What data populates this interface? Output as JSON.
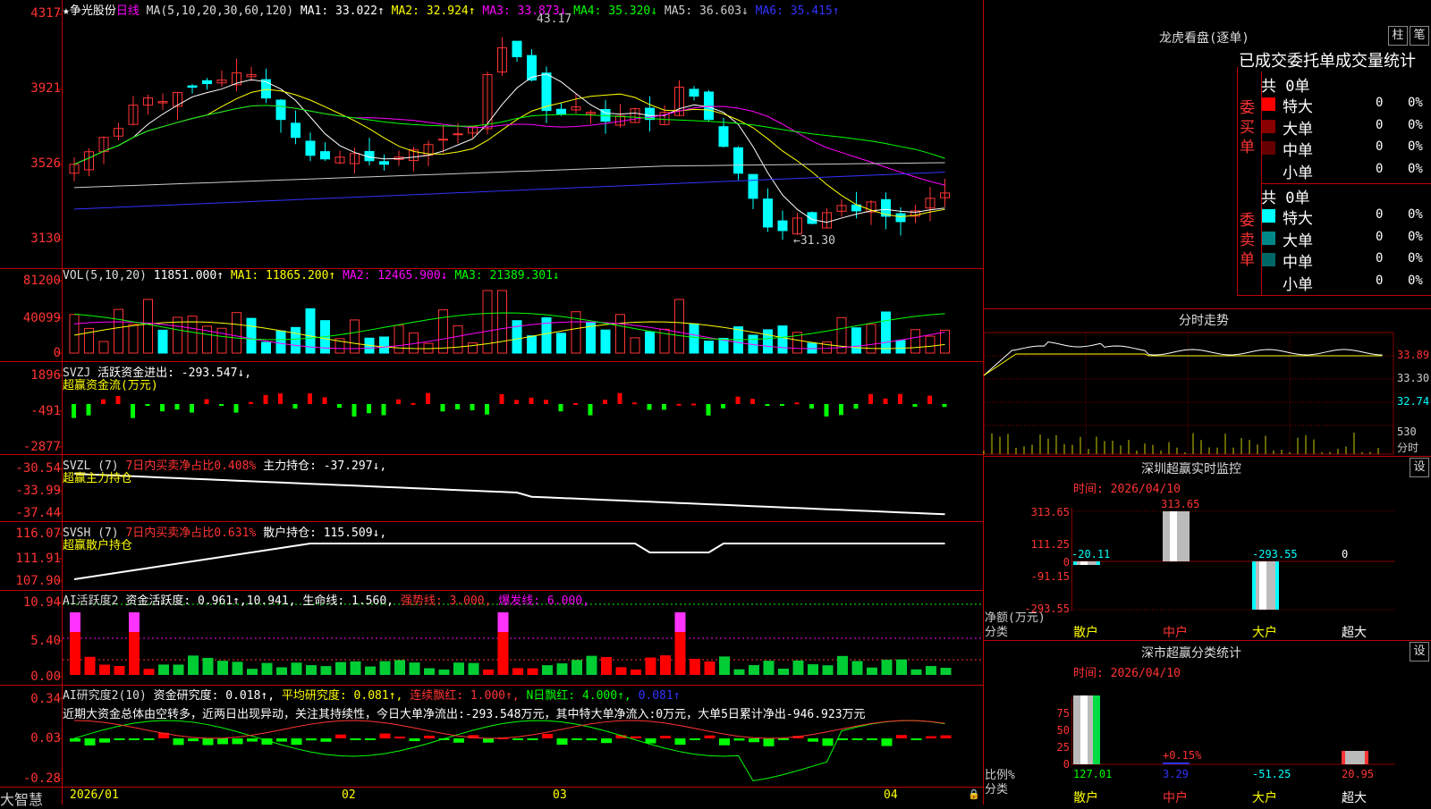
{
  "stock": {
    "name": "★争光股份",
    "period": "日线"
  },
  "main": {
    "ma_label": "MA(5,10,20,30,60,120)",
    "ma1": "MA1: 33.022↑",
    "ma2": "MA2: 32.924↑",
    "ma3": "MA3: 33.873↓",
    "ma4": "MA4: 35.320↓",
    "ma5": "MA5: 36.603↓",
    "ma6": "MA6: 35.415↑",
    "axis": [
      "4317",
      "3921",
      "3526",
      "3130"
    ],
    "high_label": "43.17",
    "low_label": "←31.30"
  },
  "vol": {
    "label": "VOL(5,10,20)",
    "val": "11851.000↑",
    "ma1": "MA1: 11865.200↑",
    "ma2": "MA2: 12465.900↓",
    "ma3": "MA3: 21389.301↓",
    "axis": [
      "81200",
      "40099",
      "0"
    ]
  },
  "svzj": {
    "label": "SVZJ",
    "text": "活跃资金进出: -293.547↓,",
    "sub": "超赢资金流(万元)",
    "axis": [
      "1896",
      "-491",
      "-2877"
    ]
  },
  "svzl": {
    "label": "SVZL (7)",
    "t1": "7日内买卖净占比0.408%",
    "t2": "主力持仓: -37.297↓,",
    "sub": "超赢主力持仓",
    "axis": [
      "-30.54",
      "-33.99",
      "-37.44"
    ]
  },
  "svsh": {
    "label": "SVSH (7)",
    "t1": "7日内买卖净占比0.631%",
    "t2": "散户持仓: 115.509↓,",
    "sub": "超赢散户持仓",
    "axis": [
      "116.07",
      "111.91",
      "107.90"
    ]
  },
  "ai1": {
    "label": "AI活跃度2",
    "t1": "资金活跃度: 0.961↑,10.941,",
    "t2": "生命线: 1.560,",
    "t3": "强势线: 3.000,",
    "t4": "爆发线: 6.000,",
    "axis": [
      "10.94",
      "5.40",
      "0.00"
    ]
  },
  "ai2": {
    "label": "AI研究度2(10)",
    "t1": "资金研究度: 0.018↑,",
    "t2": "平均研究度: 0.081↑,",
    "t3": "连续飘红: 1.000↑,",
    "t4": "N日飘红: 4.000↑,",
    "t5": "0.081↑",
    "note": "近期大资金总体由空转多，近两日出现异动，关注其持续性，今日大单净流出:-293.548万元，其中特大单净流入:0万元，大单5日累计净出-946.923万元",
    "axis": [
      "0.34",
      "0.03",
      "-0.28"
    ]
  },
  "dates": {
    "d1": "2026/01",
    "d2": "02",
    "d3": "03",
    "d4": "04"
  },
  "brand": "大智慧",
  "lhb": {
    "title": "龙虎看盘(逐单)",
    "btn1": "柱",
    "btn2": "笔",
    "subtitle": "已成交委托单成交量统计",
    "buy_label": "委买单",
    "sell_label": "委卖单",
    "buy_total": "共 0单",
    "sell_total": "共 0单",
    "rows_buy": [
      {
        "name": "特大",
        "v": "0",
        "p": "0%"
      },
      {
        "name": "大单",
        "v": "0",
        "p": "0%"
      },
      {
        "name": "中单",
        "v": "0",
        "p": "0%"
      },
      {
        "name": "小单",
        "v": "0",
        "p": "0%"
      }
    ],
    "rows_sell": [
      {
        "name": "特大",
        "v": "0",
        "p": "0%"
      },
      {
        "name": "大单",
        "v": "0",
        "p": "0%"
      },
      {
        "name": "中单",
        "v": "0",
        "p": "0%"
      },
      {
        "name": "小单",
        "v": "0",
        "p": "0%"
      }
    ]
  },
  "intraday": {
    "title": "分时走势",
    "axis": [
      "33.89",
      "33.30",
      "32.74",
      "530",
      "分时"
    ]
  },
  "monitor": {
    "title": "深圳超赢实时监控",
    "btn": "设",
    "date": "时间: 2026/04/10",
    "axis": [
      "313.65",
      "111.25",
      "0",
      "-91.15",
      "-293.55"
    ],
    "unit1": "净额(万元)",
    "unit2": "分类",
    "vals": [
      "-20.11",
      "313.65",
      "-293.55",
      "0"
    ],
    "cats": [
      "散户",
      "中户",
      "大户",
      "超大"
    ]
  },
  "classify": {
    "title": "深市超赢分类统计",
    "btn": "设",
    "date": "时间: 2026/04/10",
    "axis": [
      "75",
      "50",
      "25",
      "0"
    ],
    "unit1": "比例%",
    "unit2": "分类",
    "top": [
      "+0.15%"
    ],
    "vals": [
      "127.01",
      "3.29",
      "-51.25",
      "20.95"
    ],
    "cats": [
      "散户",
      "中户",
      "大户",
      "超大"
    ]
  }
}
